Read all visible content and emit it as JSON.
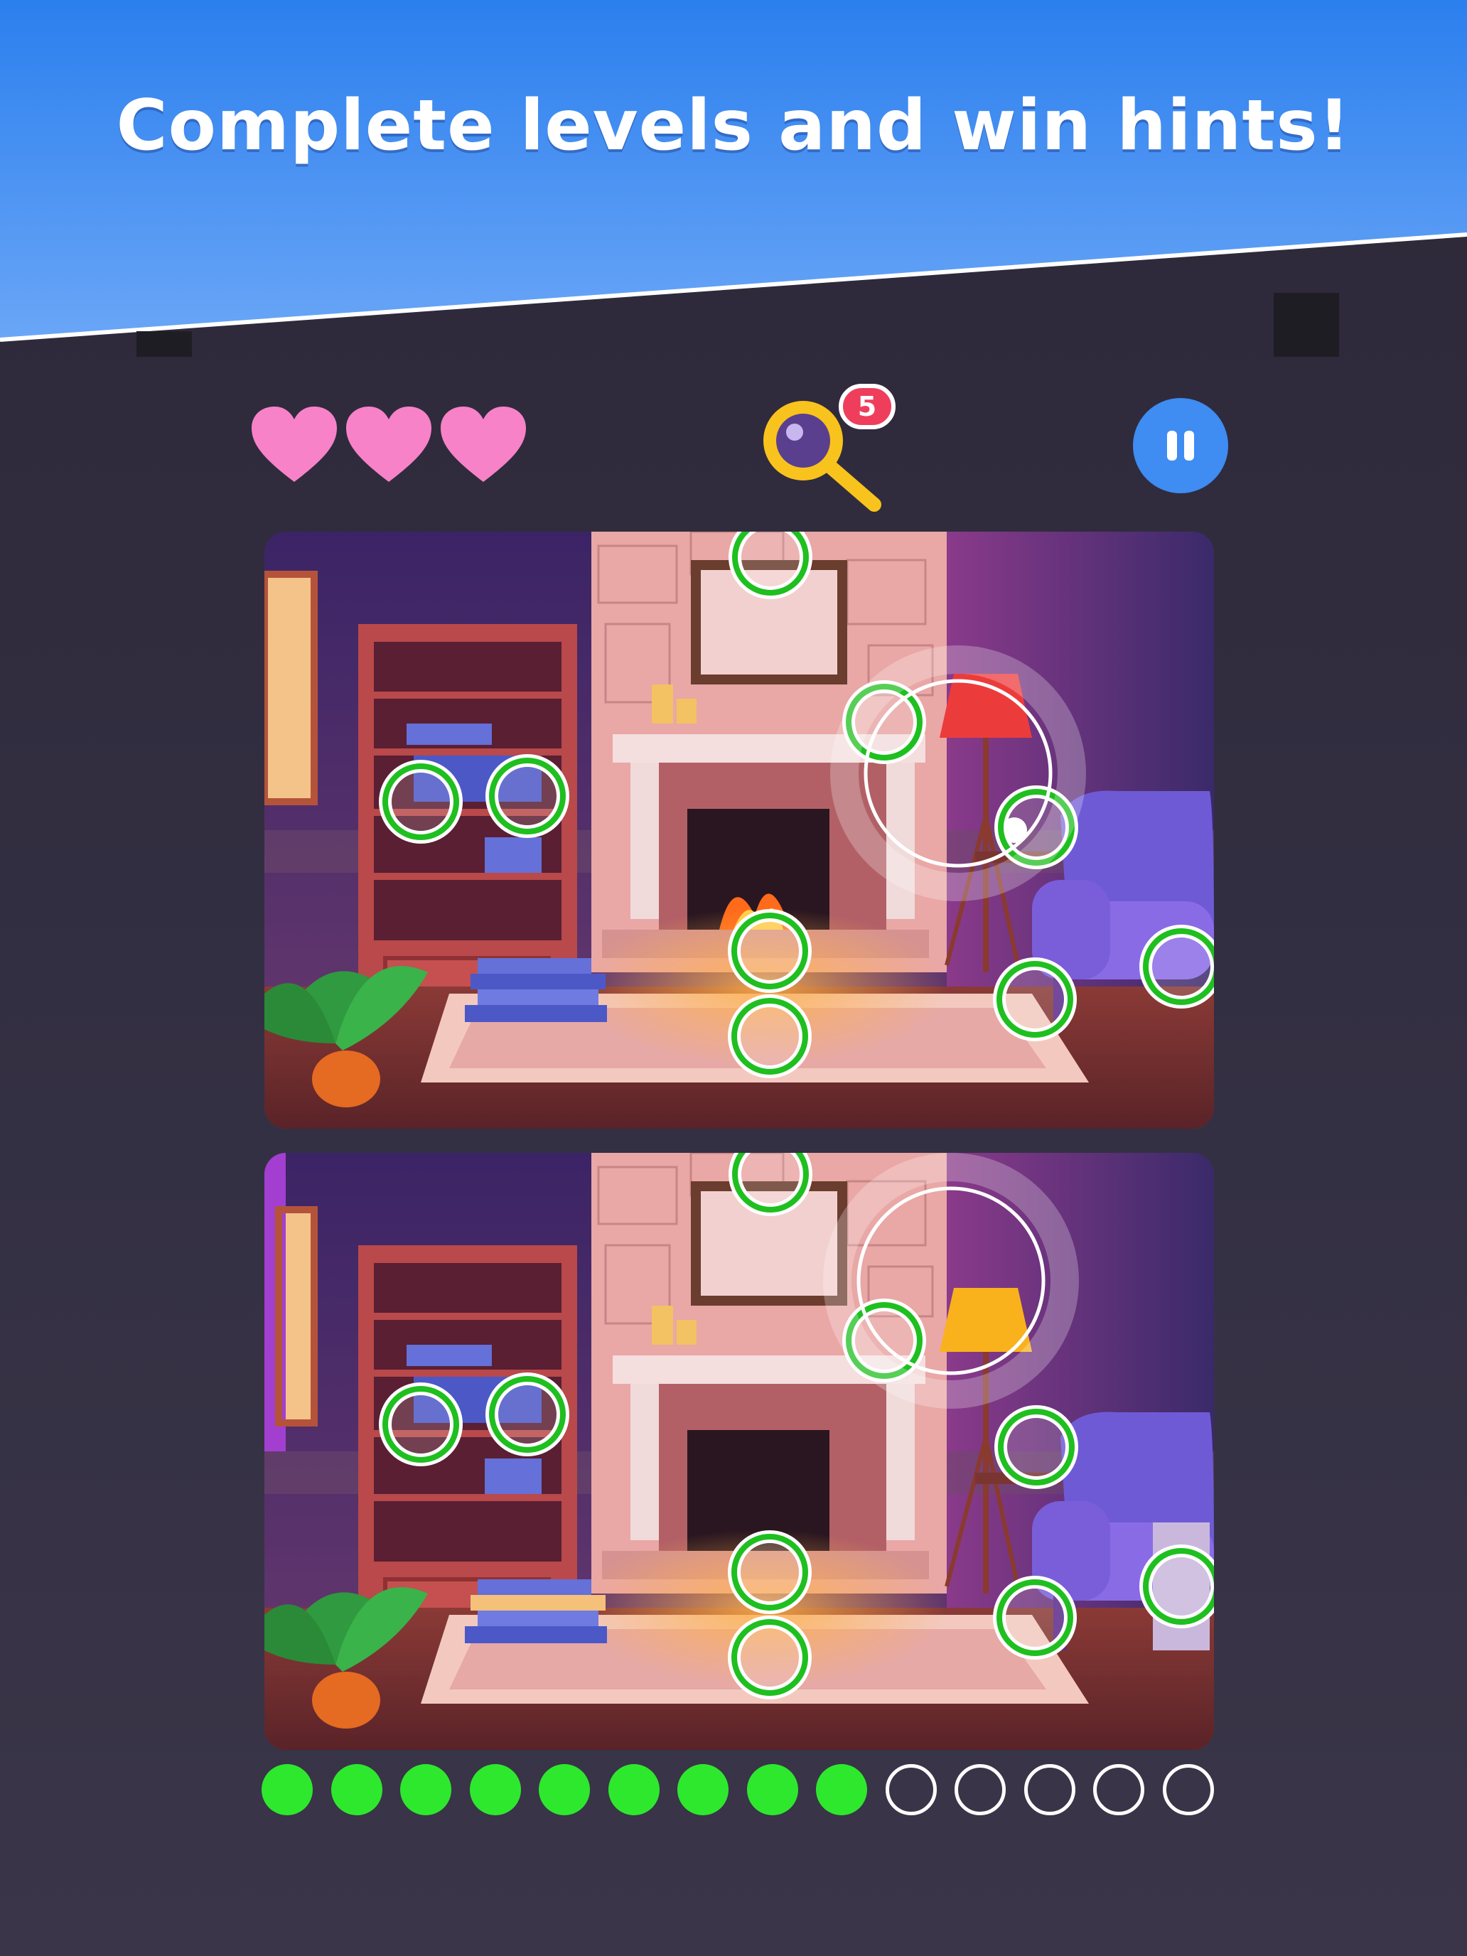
{
  "headline": "Complete levels and win hints!",
  "lives": 3,
  "hints": {
    "count": "5"
  },
  "progress": {
    "found": 9,
    "total": 14
  },
  "colors": {
    "banner_top": "#2b7fee",
    "banner_bottom": "#6aa6f7",
    "heart": "#f882c8",
    "found_marker": "#1fbf1f",
    "hint_magnifier": "#f9c31d",
    "hint_badge": "#ef3e5c",
    "pause_button": "#3f8cf2",
    "progress_on": "#2ee82e",
    "progress_off": "#ffffff",
    "lamp_top_image": "#ec3b3b",
    "lamp_bottom_image": "#f9b21c"
  },
  "icons": {
    "heart": "heart-icon",
    "hint": "magnifier-icon",
    "pause": "pause-icon"
  }
}
